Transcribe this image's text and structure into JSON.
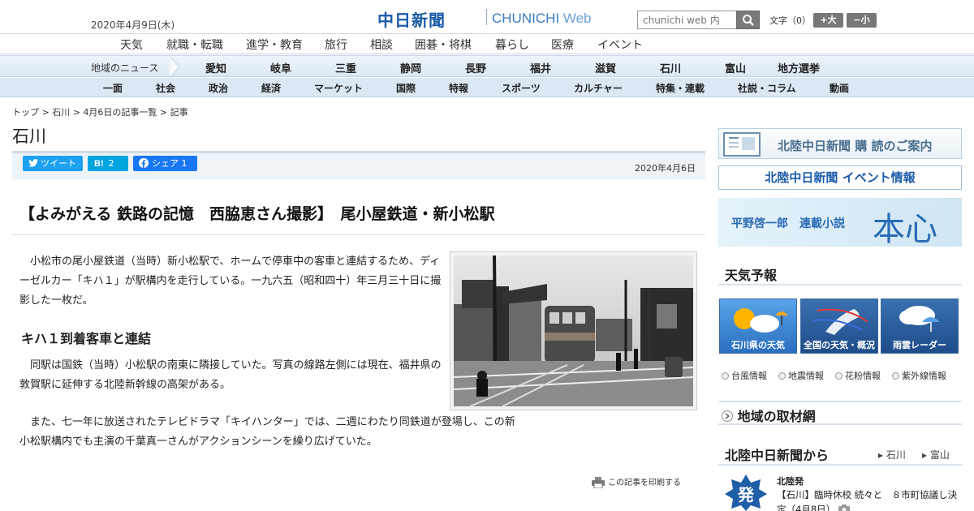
{
  "header": {
    "date": "2020年4月9日(木)",
    "logo_ja": "中日新聞",
    "logo_en": "CHUNICHI",
    "logo_web": "Web",
    "search_placeholder": "chunichi web 内",
    "font_size_label": "文字（0）",
    "font_increase": "+大",
    "font_decrease": "−小"
  },
  "subnav": [
    "天気",
    "就職・転職",
    "進学・教育",
    "旅行",
    "相談",
    "囲碁・将棋",
    "暮らし",
    "医療",
    "イベント"
  ],
  "region_nav": {
    "label": "地域のニュース",
    "items": [
      "愛知",
      "岐阜",
      "三重",
      "静岡",
      "長野",
      "福井",
      "滋賀",
      "石川",
      "富山",
      "地方選挙"
    ]
  },
  "category_nav": [
    "一面",
    "社会",
    "政治",
    "経済",
    "マーケット",
    "国際",
    "特報",
    "スポーツ",
    "カルチャー",
    "特集・連載",
    "社説・コラム",
    "動画"
  ],
  "breadcrumb": [
    "トップ",
    "石川",
    "4月6日の記事一覧",
    "記事"
  ],
  "section_title": "石川",
  "share": {
    "tweet": "ツイート",
    "hatena": "2",
    "facebook": "シェア",
    "facebook_count": "1"
  },
  "pub_date": "2020年4月6日",
  "article": {
    "headline": "【よみがえる 鉄路の記憶　西脇恵さん撮影】　尾小屋鉄道・新小松駅",
    "p1": "小松市の尾小屋鉄道（当時）新小松駅で、ホームで停車中の客車と連結するため、ディーゼルカー「キハ１」が駅構内を走行している。一九六五（昭和四十）年三月三十日に撮影した一枚だ。",
    "subhead": "キハ１到着客車と連結",
    "p2": "同駅は国鉄（当時）小松駅の南東に隣接していた。写真の線路左側には現在、福井県の敦賀駅に延伸する北陸新幹線の高架がある。",
    "p3": "また、七一年に放送されたテレビドラマ「キイハンター」では、二週にわたり同鉄道が登場し、この新小松駅構内でも主演の千葉真一さんがアクションシーンを繰り広げていた。",
    "print": "この記事を印刷する"
  },
  "sidebar": {
    "subscribe": "北陸中日新聞 購 読のご案内",
    "event": "北陸中日新聞 イベント情報",
    "novel_author": "平野啓一郎　連載小説",
    "novel_title": "本心",
    "weather_heading": "天気予報",
    "tiles": [
      "石川県の天気",
      "全国の天気・概況",
      "雨雲レーダー"
    ],
    "weather_links": [
      "台風情報",
      "地震情報",
      "花粉情報",
      "紫外線情報"
    ],
    "network_heading": "地域の取材網",
    "from_heading": "北陸中日新聞から",
    "from_tabs": [
      "石川",
      "富山"
    ],
    "news_label": "北陸発",
    "news_badge": "発",
    "news_text": "【石川】臨時休校 続々と　８市町協議し決定（4月8日）"
  }
}
